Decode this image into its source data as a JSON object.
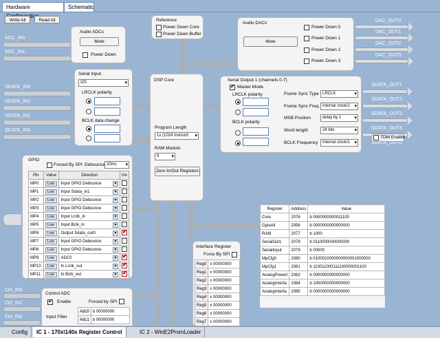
{
  "tabs": [
    "Hardware Configuration",
    "Schematic"
  ],
  "toolbar": {
    "write_all": "Write All",
    "read_all": "Read All"
  },
  "inputs": {
    "adc": [
      "ADC_IN0",
      "ADC_IN1"
    ],
    "sdata": [
      "SDATA_IN0",
      "SDATA_IN1",
      "SDATA_IN2",
      "SDATA_IN3"
    ],
    "ctrl": [
      "Ctrl_IN0",
      "Ctrl_IN1",
      "Ctrl_IN2"
    ]
  },
  "outputs": {
    "dac": [
      "DAC_OUT0",
      "DAC_OUT1",
      "DAC_OUT2",
      "DAC_OUT3"
    ],
    "sdata": [
      "SDATA_OUT1",
      "SDATA_OUT2",
      "SDATA_OUT3",
      "SDATA_OUT4",
      "SDATA_OUT0"
    ]
  },
  "audio_adcs": {
    "title": "Audio ADCs",
    "mute": "Mute",
    "power_down": "Power Down"
  },
  "reference": {
    "title": "Reference",
    "power_down_core": "Power Down Core",
    "power_down_buffer": "Power Down Buffer"
  },
  "audio_dacs": {
    "title": "Audio DACs",
    "mute": "Mute",
    "power_downs": [
      "Power Down 0",
      "Power Down 1",
      "Power Down 2",
      "Power Down 3"
    ]
  },
  "serial_input": {
    "title": "Serial Input",
    "mode": "I2S",
    "lrclk_polarity": "LRCLK polarity",
    "bclk_data_change": "BCLK data change"
  },
  "dsp_core": {
    "title": "DSP Core",
    "program_length_label": "Program Length",
    "program_length": "1x (1024 Instructi",
    "ram_modulo_label": "RAM Modulo",
    "ram_modulo": "8",
    "zero_btn": "Zero In/Out Registers"
  },
  "serial_output": {
    "title": "Serial Output 1 (channels 0-7)",
    "master_mode": "Master Mode",
    "lrclk_polarity": "LRCLK polarity",
    "bclk_polarity": "BCLK polarity",
    "fields": [
      {
        "label": "Frame Sync Type",
        "value": "LRCLK"
      },
      {
        "label": "Frame Sync Freq.",
        "value": "internal clock/1"
      },
      {
        "label": "MSB Position",
        "value": "delay by 1"
      },
      {
        "label": "Word length",
        "value": "24 bits"
      },
      {
        "label": "BCLK Frequency",
        "value": "internal clock/1"
      }
    ],
    "tdm_enable": "TDM Enable"
  },
  "gpio": {
    "title": "GPIO",
    "forced_by_spi": "Forced By SPI",
    "debounce_label": "Debounce",
    "debounce": "20ms",
    "headers": [
      "Pin",
      "Value",
      "Direction",
      "Inv"
    ],
    "rows": [
      {
        "pin": "MP0",
        "value": "Low",
        "direction": "Input GPIO Debounce",
        "inv": false
      },
      {
        "pin": "MP1",
        "value": "Low",
        "direction": "Input Sdata_in1",
        "inv": false
      },
      {
        "pin": "MP2",
        "value": "Low",
        "direction": "Input GPIO Debounce",
        "inv": false
      },
      {
        "pin": "MP3",
        "value": "Low",
        "direction": "Input GPIO Debounce",
        "inv": false
      },
      {
        "pin": "MP4",
        "value": "Low",
        "direction": "Input Lrclk_in",
        "inv": false
      },
      {
        "pin": "MP5",
        "value": "Low",
        "direction": "Input Bclk_in",
        "inv": false
      },
      {
        "pin": "MP6",
        "value": "Low",
        "direction": "Output Sdata_out0",
        "inv": true
      },
      {
        "pin": "MP7",
        "value": "Low",
        "direction": "Input GPIO Debounce",
        "inv": false
      },
      {
        "pin": "MP8",
        "value": "Low",
        "direction": "Input GPIO Debounce",
        "inv": false
      },
      {
        "pin": "MP9",
        "value": "Low",
        "direction": "ADC0",
        "inv": true
      },
      {
        "pin": "MP10",
        "value": "Low",
        "direction": "In Lrclk_out",
        "inv": true
      },
      {
        "pin": "MP11",
        "value": "Low",
        "direction": "In Bclk_out",
        "inv": true
      }
    ]
  },
  "registers": {
    "headers": [
      "Register",
      "Address",
      "Value"
    ],
    "rows": [
      {
        "name": "Core",
        "address": "2076",
        "value": "b 0000000000011100"
      },
      {
        "name": "GpioAll",
        "address": "2056",
        "value": "b 0000000000000000"
      },
      {
        "name": "RAM",
        "address": "2077",
        "value": "b 1000"
      },
      {
        "name": "SerialOut1",
        "address": "2078",
        "value": "b 0110000000000000"
      },
      {
        "name": "SerialInput",
        "address": "2079",
        "value": "b 00000"
      },
      {
        "name": "MpCfg0",
        "address": "2080",
        "value": "b 0100010000000000001000000"
      },
      {
        "name": "MpCfg1",
        "address": "2081",
        "value": "b 110011000111100000001100"
      },
      {
        "name": "AnalogPowerI",
        "address": "2082",
        "value": "b 0000000000000000"
      },
      {
        "name": "AnalogInterfa",
        "address": "2084",
        "value": "b 1000000000000000"
      },
      {
        "name": "AnalogInterfa",
        "address": "2085",
        "value": "b 0000000000000000"
      }
    ]
  },
  "interface_register": {
    "title": "Interface Register",
    "forced_by_spi": "Force By SPI",
    "rows": [
      {
        "name": "Reg0",
        "value": "x 00000000"
      },
      {
        "name": "Reg1",
        "value": "x 00000000"
      },
      {
        "name": "Reg2",
        "value": "x 00000000"
      },
      {
        "name": "Reg3",
        "value": "x 00000000"
      },
      {
        "name": "Reg4",
        "value": "x 00000000"
      },
      {
        "name": "Reg5",
        "value": "x 00000000"
      },
      {
        "name": "Reg6",
        "value": "x 00000000"
      },
      {
        "name": "Reg7",
        "value": "x 00000000"
      }
    ]
  },
  "control_adc": {
    "title": "Control ADC",
    "enable": "Enable",
    "forced_by_spi": "Forced by SPI",
    "input_filter": "Input Filter",
    "rows": [
      {
        "name": "Adc0",
        "value": "b 00000000"
      },
      {
        "name": "Adc1",
        "value": "b 00000000"
      }
    ]
  },
  "bottom_tabs": [
    "Config",
    "IC 1 - 170x\\140x Register Control",
    "IC 2 - WinE2PromLoader"
  ]
}
